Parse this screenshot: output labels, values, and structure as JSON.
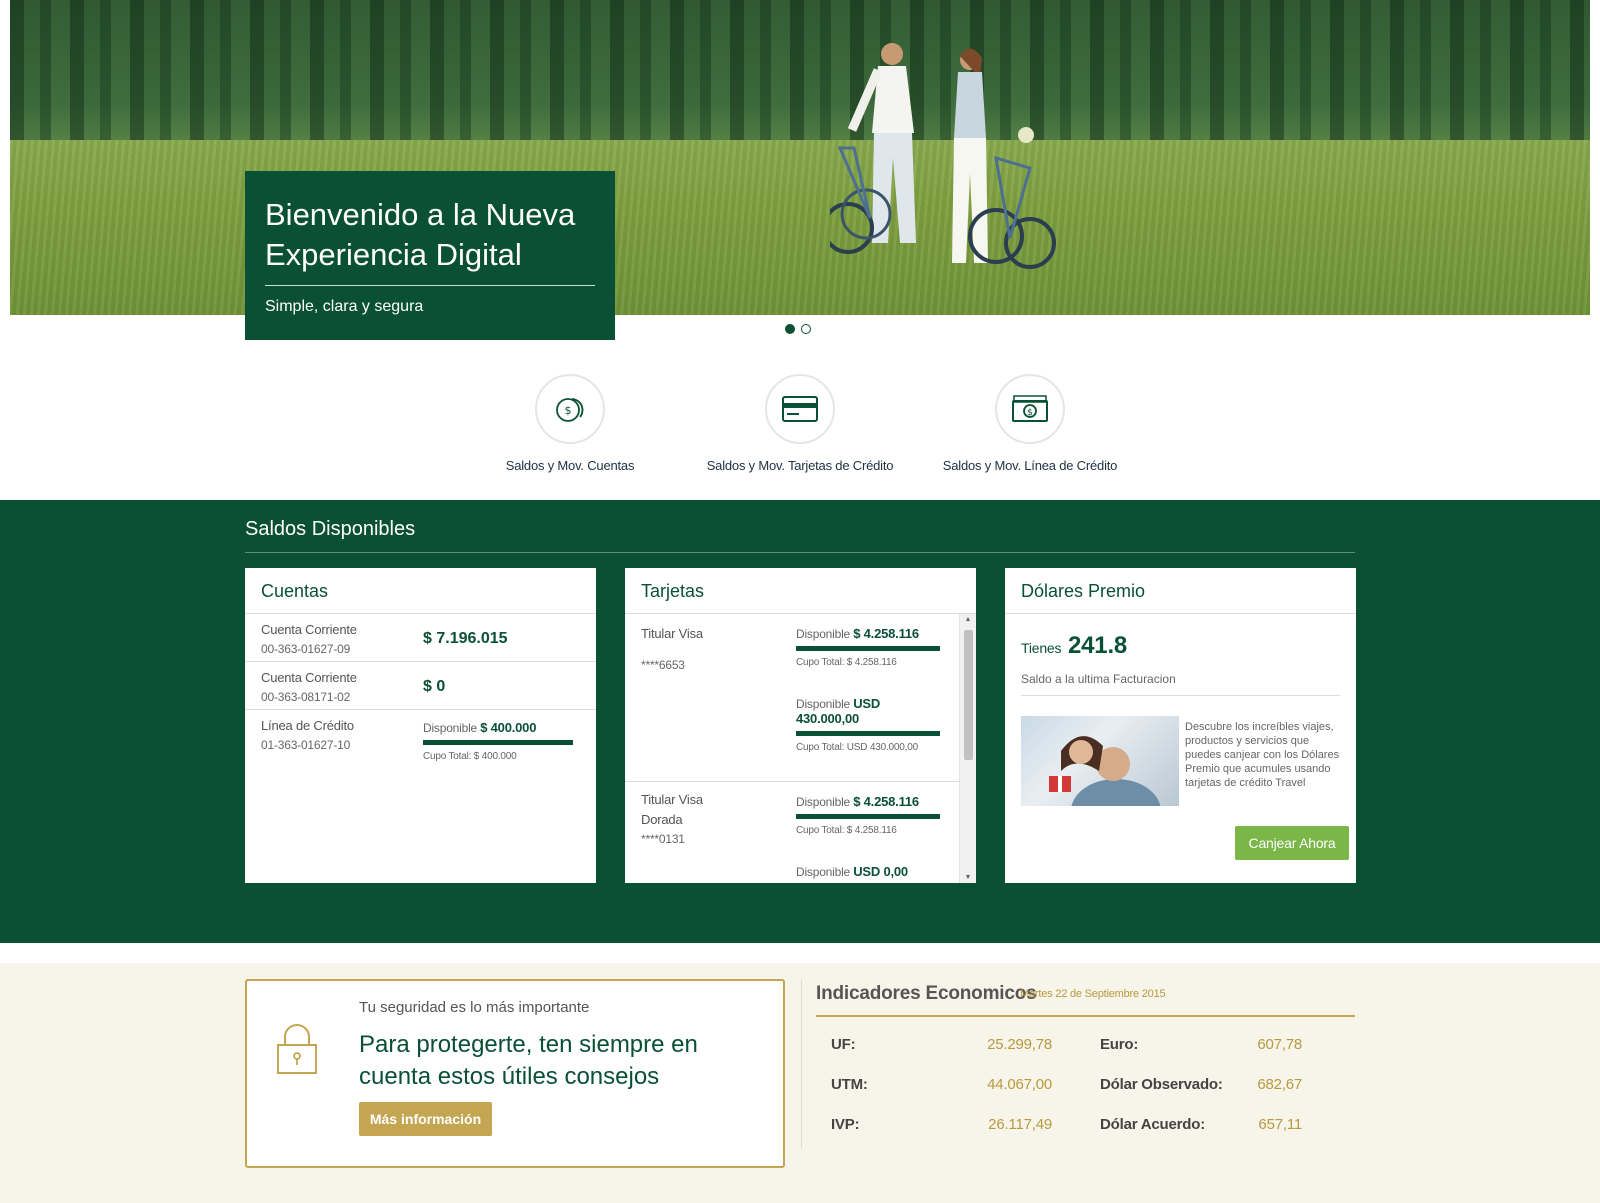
{
  "hero": {
    "title": "Bienvenido a la Nueva Experiencia Digital",
    "subtitle": "Simple, clara y segura",
    "slides": 2,
    "active_slide": 1
  },
  "quick_access": [
    {
      "label": "Saldos y Mov. Cuentas",
      "icon": "coins-icon"
    },
    {
      "label": "Saldos y Mov. Tarjetas de Crédito",
      "icon": "credit-card-icon"
    },
    {
      "label": "Saldos y Mov. Línea de Crédito",
      "icon": "banknote-icon"
    }
  ],
  "saldos": {
    "title": "Saldos Disponibles",
    "cuentas": {
      "title": "Cuentas",
      "rows": [
        {
          "name": "Cuenta Corriente",
          "number": "00-363-01627-09",
          "amount": "$ 7.196.015"
        },
        {
          "name": "Cuenta Corriente",
          "number": "00-363-08171-02",
          "amount": "$ 0"
        }
      ],
      "linea": {
        "name": "Línea de Crédito",
        "number": "01-363-01627-10",
        "disponible_label": "Disponible",
        "disponible_value": "$ 400.000",
        "cupo": "Cupo Total: $ 400.000",
        "fill": 1.0
      }
    },
    "tarjetas": {
      "title": "Tarjetas",
      "cards": [
        {
          "holder": "Titular Visa",
          "number": "****6653",
          "clp_label": "Disponible",
          "clp_value": "$ 4.258.116",
          "clp_cupo": "Cupo Total: $ 4.258.116",
          "usd_label": "Disponible",
          "usd_value": "USD 430.000,00",
          "usd_cupo": "Cupo Total: USD 430.000,00"
        },
        {
          "holder": "Titular Visa Dorada",
          "number": "****0131",
          "clp_label": "Disponible",
          "clp_value": "$ 4.258.116",
          "clp_cupo": "Cupo Total: $ 4.258.116",
          "usd_label": "Disponible",
          "usd_value": "USD 0,00"
        }
      ]
    },
    "dolares": {
      "title": "Dólares Premio",
      "tienes": "Tienes",
      "amount": "241.8",
      "saldo_label": "Saldo a la ultima Facturacion",
      "promo": "Descubre los increíbles viajes, productos y servicios que puedes canjear con los Dólares Premio que acumules usando tarjetas de crédito Travel",
      "button": "Canjear Ahora"
    }
  },
  "security": {
    "small": "Tu seguridad es lo más importante",
    "big": "Para protegerte, ten siempre en cuenta estos útiles consejos",
    "button": "Más información"
  },
  "indicadores": {
    "title": "Indicadores Economicos",
    "date": "Martes 22 de Septiembre 2015",
    "left": [
      {
        "label": "UF:",
        "value": "25.299,78"
      },
      {
        "label": "UTM:",
        "value": "44.067,00"
      },
      {
        "label": "IVP:",
        "value": "26.117,49"
      }
    ],
    "right": [
      {
        "label": "Euro:",
        "value": "607,78"
      },
      {
        "label": "Dólar Observado:",
        "value": "682,67"
      },
      {
        "label": "Dólar Acuerdo:",
        "value": "657,11"
      }
    ]
  },
  "colors": {
    "brand_green": "#0a5035",
    "gold": "#c4a652",
    "button_green": "#7ab648",
    "cream": "#f7f4e9"
  }
}
